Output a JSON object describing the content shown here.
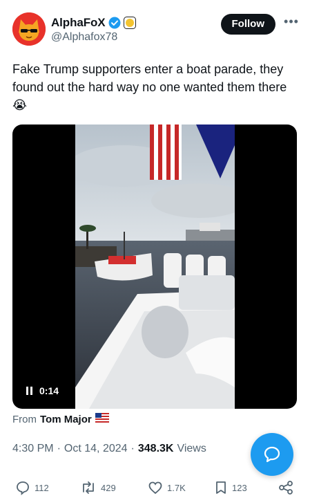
{
  "author": {
    "display_name": "AlphaFoX",
    "handle": "@Alphafox78",
    "verified_color": "#1d9bf0",
    "affiliate_badge_color": "#f4c430"
  },
  "follow_label": "Follow",
  "tweet_text": "Fake Trump supporters enter a boat parade, they found out the hard way no one wanted them there 😭",
  "video": {
    "time": "0:14"
  },
  "source": {
    "prefix": "From",
    "name": "Tom Major",
    "flag": "us-flag-icon"
  },
  "meta": {
    "time": "4:30 PM",
    "date": "Oct 14, 2024",
    "views_count": "348.3K",
    "views_label": "Views"
  },
  "actions": {
    "replies": "112",
    "reposts": "429",
    "likes": "1.7K",
    "bookmarks": "123"
  },
  "accent_color": "#1d9bf0"
}
